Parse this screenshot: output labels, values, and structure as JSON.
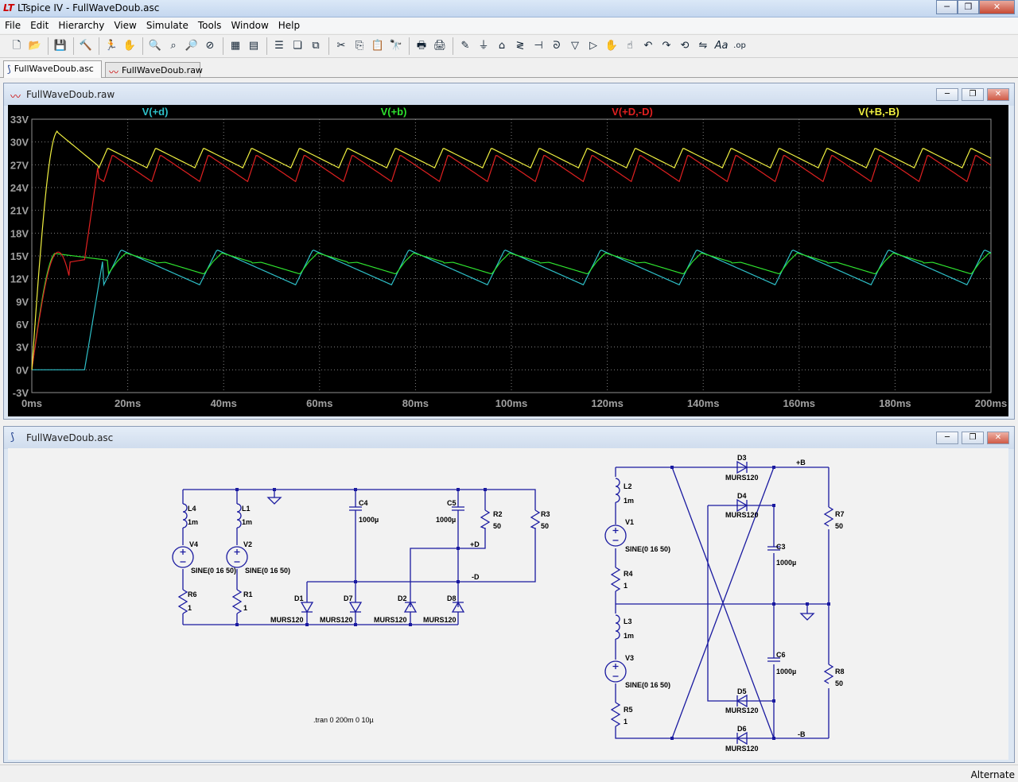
{
  "window": {
    "title": "LTspice IV - FullWaveDoub.asc",
    "min": "─",
    "max": "❐",
    "close": "✕"
  },
  "menu": [
    "File",
    "Edit",
    "Hierarchy",
    "View",
    "Simulate",
    "Tools",
    "Window",
    "Help"
  ],
  "toolbar_icons": [
    "new-schematic-icon",
    "open-icon",
    "save-icon",
    "control-panel-icon",
    "run-icon",
    "pan-icon",
    "zoom-in-icon",
    "zoom-to-fit-icon",
    "zoom-out-icon",
    "cancel-zoom-icon",
    "autorange-icon",
    "autoscale-icon",
    "tile-horizontal-icon",
    "cascade-icon",
    "tile-icon",
    "cut-icon",
    "copy-icon",
    "paste-icon",
    "find-icon",
    "print-setup-icon",
    "print-icon",
    "draw-wire-icon",
    "ground-icon",
    "label-net-icon",
    "resistor-icon",
    "capacitor-icon",
    "inductor-icon",
    "diode-icon",
    "component-icon",
    "move-icon",
    "drag-icon",
    "undo-icon",
    "redo-icon",
    "rotate-icon",
    "mirror-icon",
    "text-icon",
    "spice-directive-icon"
  ],
  "tabs": [
    {
      "label": "FullWaveDoub.asc",
      "active": true
    },
    {
      "label": "FullWaveDoub.raw",
      "active": false
    }
  ],
  "plot_window": {
    "title": "FullWaveDoub.raw"
  },
  "schematic_window": {
    "title": "FullWaveDoub.asc"
  },
  "chart_data": {
    "type": "line",
    "background": "#000000",
    "grid": true,
    "legend_position": "top",
    "ylim": [
      -3,
      33
    ],
    "xlim": [
      0,
      200
    ],
    "y_ticks": [
      "33V",
      "30V",
      "27V",
      "24V",
      "21V",
      "18V",
      "15V",
      "12V",
      "9V",
      "6V",
      "3V",
      "0V",
      "-3V"
    ],
    "x_ticks": [
      "0ms",
      "20ms",
      "40ms",
      "60ms",
      "80ms",
      "100ms",
      "120ms",
      "140ms",
      "160ms",
      "180ms",
      "200ms"
    ],
    "series": [
      {
        "name": "V(+d)",
        "color": "#2ec0c8"
      },
      {
        "name": "V(+b)",
        "color": "#2ee02e"
      },
      {
        "name": "V(+D,-D)",
        "color": "#e02020"
      },
      {
        "name": "V(+B,-B)",
        "color": "#f0f040"
      }
    ]
  },
  "schematic": {
    "labels": {
      "L4": "L4",
      "L1": "L1",
      "L2": "L2",
      "L3": "L3",
      "ind_val": "1m",
      "V4": "V4",
      "V2": "V2",
      "V1": "V1",
      "V3": "V3",
      "sine": "SINE(0 16 50)",
      "R6": "R6",
      "R1": "R1",
      "R4": "R4",
      "R5": "R5",
      "r_small": "1",
      "R2": "R2",
      "R3": "R3",
      "R7": "R7",
      "R8": "R8",
      "r_load": "50",
      "C4": "C4",
      "C5": "C5",
      "C3": "C3",
      "C6": "C6",
      "cap_val": "1000µ",
      "D1": "D1",
      "D7": "D7",
      "D2": "D2",
      "D8": "D8",
      "D3": "D3",
      "D4": "D4",
      "D5": "D5",
      "D6": "D6",
      "diode_model": "MURS120",
      "net_pD": "+D",
      "net_mD": "-D",
      "net_pB": "+B",
      "net_mB": "-B",
      "directive": ".tran 0 200m 0 10µ"
    }
  },
  "status": {
    "right": "Alternate"
  }
}
